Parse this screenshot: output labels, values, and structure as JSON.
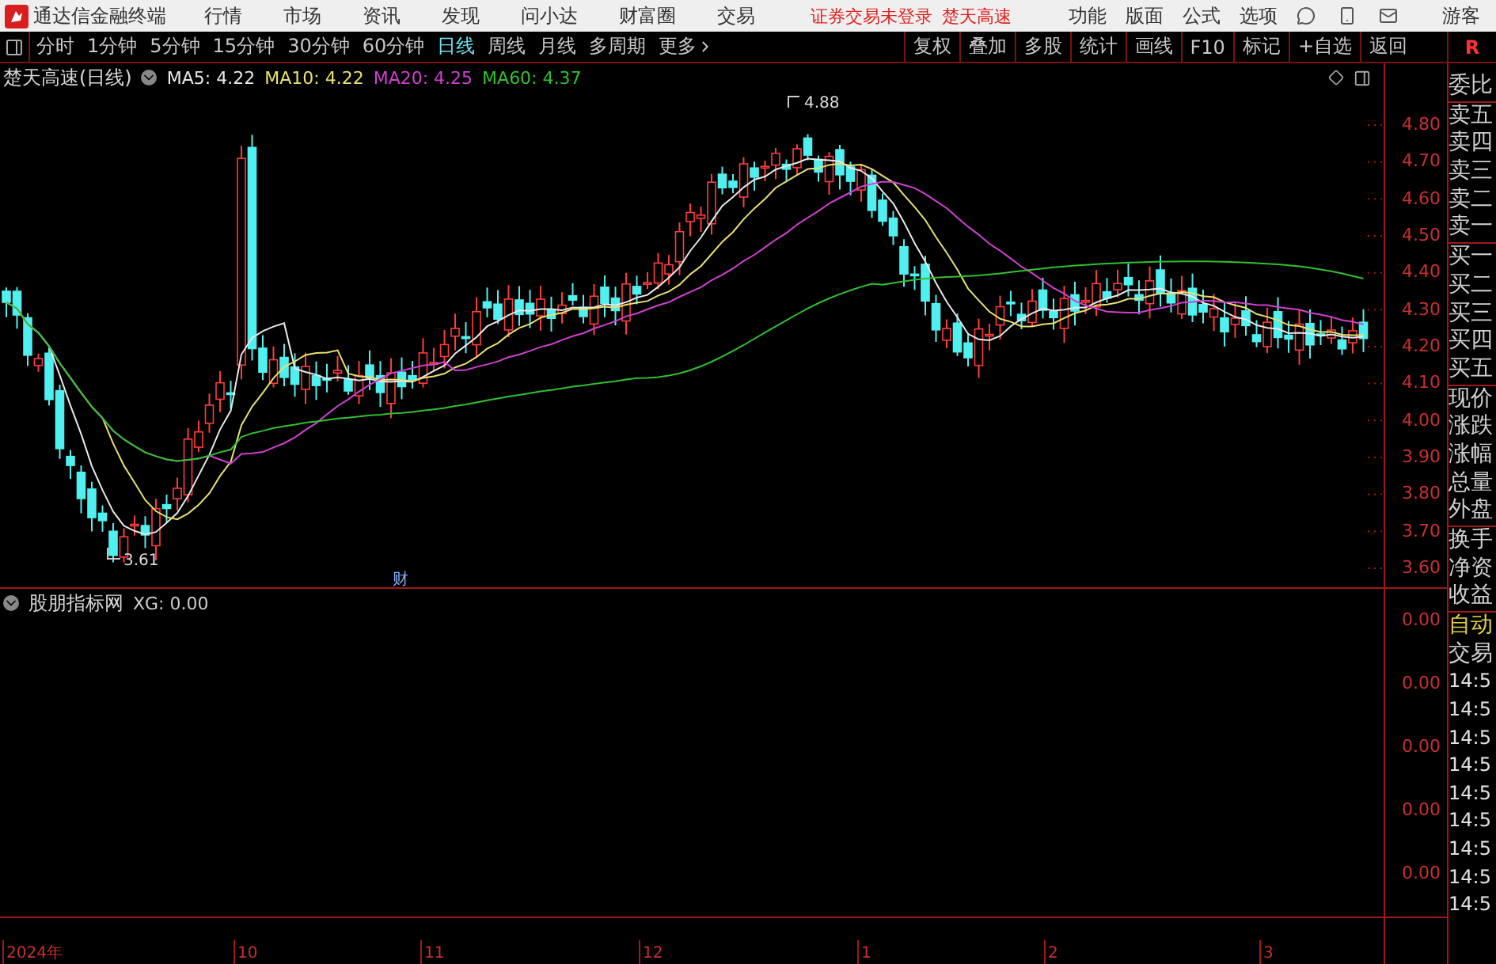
{
  "app": {
    "title": "通达信金融终端",
    "menu": [
      "行情",
      "市场",
      "资讯",
      "发现",
      "问小达",
      "财富圈",
      "交易"
    ],
    "status": [
      "证券交易未登录",
      "楚天高速"
    ],
    "menu_right": [
      "功能",
      "版面",
      "公式",
      "选项"
    ],
    "user": "游客"
  },
  "periods": [
    {
      "label": "分时",
      "selected": false
    },
    {
      "label": "1分钟",
      "selected": false
    },
    {
      "label": "5分钟",
      "selected": false
    },
    {
      "label": "15分钟",
      "selected": false
    },
    {
      "label": "30分钟",
      "selected": false
    },
    {
      "label": "60分钟",
      "selected": false
    },
    {
      "label": "日线",
      "selected": true
    },
    {
      "label": "周线",
      "selected": false
    },
    {
      "label": "月线",
      "selected": false
    },
    {
      "label": "多周期",
      "selected": false
    },
    {
      "label": "更多",
      "selected": false
    }
  ],
  "tools": [
    "复权",
    "叠加",
    "多股",
    "统计",
    "画线",
    "F10",
    "标记",
    "+自选",
    "返回"
  ],
  "side_tab": "R",
  "chart": {
    "title": "楚天高速(日线)",
    "ma": [
      {
        "name": "MA5:",
        "value": "4.22",
        "color": "#e8e8e8"
      },
      {
        "name": "MA10:",
        "value": "4.22",
        "color": "#e8e070"
      },
      {
        "name": "MA20:",
        "value": "4.25",
        "color": "#d040d0"
      },
      {
        "name": "MA60:",
        "value": "4.37",
        "color": "#30c030"
      }
    ],
    "price_ticks": [
      "4.80",
      "4.70",
      "4.60",
      "4.50",
      "4.40",
      "4.30",
      "4.20",
      "4.10",
      "4.00",
      "3.90",
      "3.80",
      "3.70",
      "3.60"
    ],
    "high_label": "4.88",
    "low_label": "3.61",
    "event_marker": "财",
    "x_labels": [
      "2024年",
      "10",
      "11",
      "12",
      "1",
      "2",
      "3"
    ]
  },
  "indicator": {
    "title": "股朋指标网",
    "reading": "XG: 0.00",
    "ticks": [
      "0.00",
      "0.00",
      "0.00",
      "0.00",
      "0.00"
    ]
  },
  "quote_panel": {
    "groups": [
      [
        "委比"
      ],
      [
        "卖五",
        "卖四",
        "卖三",
        "卖二",
        "卖一"
      ],
      [
        "买一",
        "买二",
        "买三",
        "买四",
        "买五"
      ],
      [
        "现价",
        "涨跌",
        "涨幅",
        "总量",
        "外盘"
      ],
      [
        "换手",
        "净资",
        "收益"
      ]
    ],
    "auto": "自动",
    "trade": "交易",
    "times": [
      "14:5",
      "14:5",
      "14:5",
      "14:5",
      "14:5",
      "14:5",
      "14:5",
      "14:5",
      "14:5"
    ]
  }
}
